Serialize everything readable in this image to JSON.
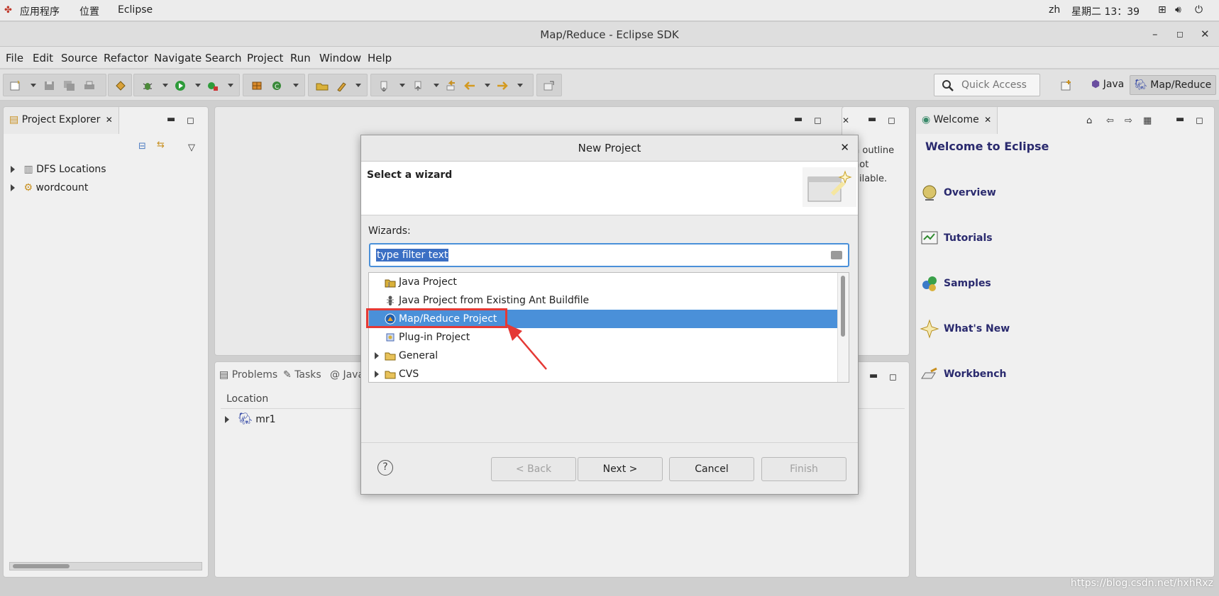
{
  "system_bar": {
    "applications": "应用程序",
    "places": "位置",
    "app_name": "Eclipse",
    "lang": "zh",
    "clock": "星期二 13：39"
  },
  "window": {
    "title": "Map/Reduce - Eclipse SDK"
  },
  "menu": [
    "File",
    "Edit",
    "Source",
    "Refactor",
    "Navigate",
    "Search",
    "Project",
    "Run",
    "Window",
    "Help"
  ],
  "toolbar": {
    "quick_access_placeholder": "Quick Access",
    "perspective_java": "Java",
    "perspective_mapreduce": "Map/Reduce"
  },
  "project_explorer": {
    "tab": "Project Explorer",
    "items": [
      "DFS Locations",
      "wordcount"
    ]
  },
  "outline": {
    "partial_text": [
      "n outline",
      "not",
      "ailable."
    ]
  },
  "bottom_panel": {
    "tabs": [
      "Problems",
      "Tasks",
      "Java"
    ],
    "column": "Location",
    "row": "mr1"
  },
  "welcome": {
    "tab": "Welcome",
    "title": "Welcome to Eclipse",
    "items": [
      "Overview",
      "Tutorials",
      "Samples",
      "What's New",
      "Workbench"
    ]
  },
  "dialog": {
    "title": "New Project",
    "heading": "Select a wizard",
    "wizards_label": "Wizards:",
    "filter_value": "type filter text",
    "list": [
      "Java Project",
      "Java Project from Existing Ant Buildfile",
      "Map/Reduce Project",
      "Plug-in Project",
      "General",
      "CVS"
    ],
    "buttons": {
      "back": "< Back",
      "next": "Next >",
      "cancel": "Cancel",
      "finish": "Finish"
    },
    "help": "?"
  },
  "watermark": "https://blog.csdn.net/hxhRxz",
  "colors": {
    "selection": "#4a90d9",
    "highlight_box": "#e53935",
    "welcome_text": "#2a2a6e"
  }
}
